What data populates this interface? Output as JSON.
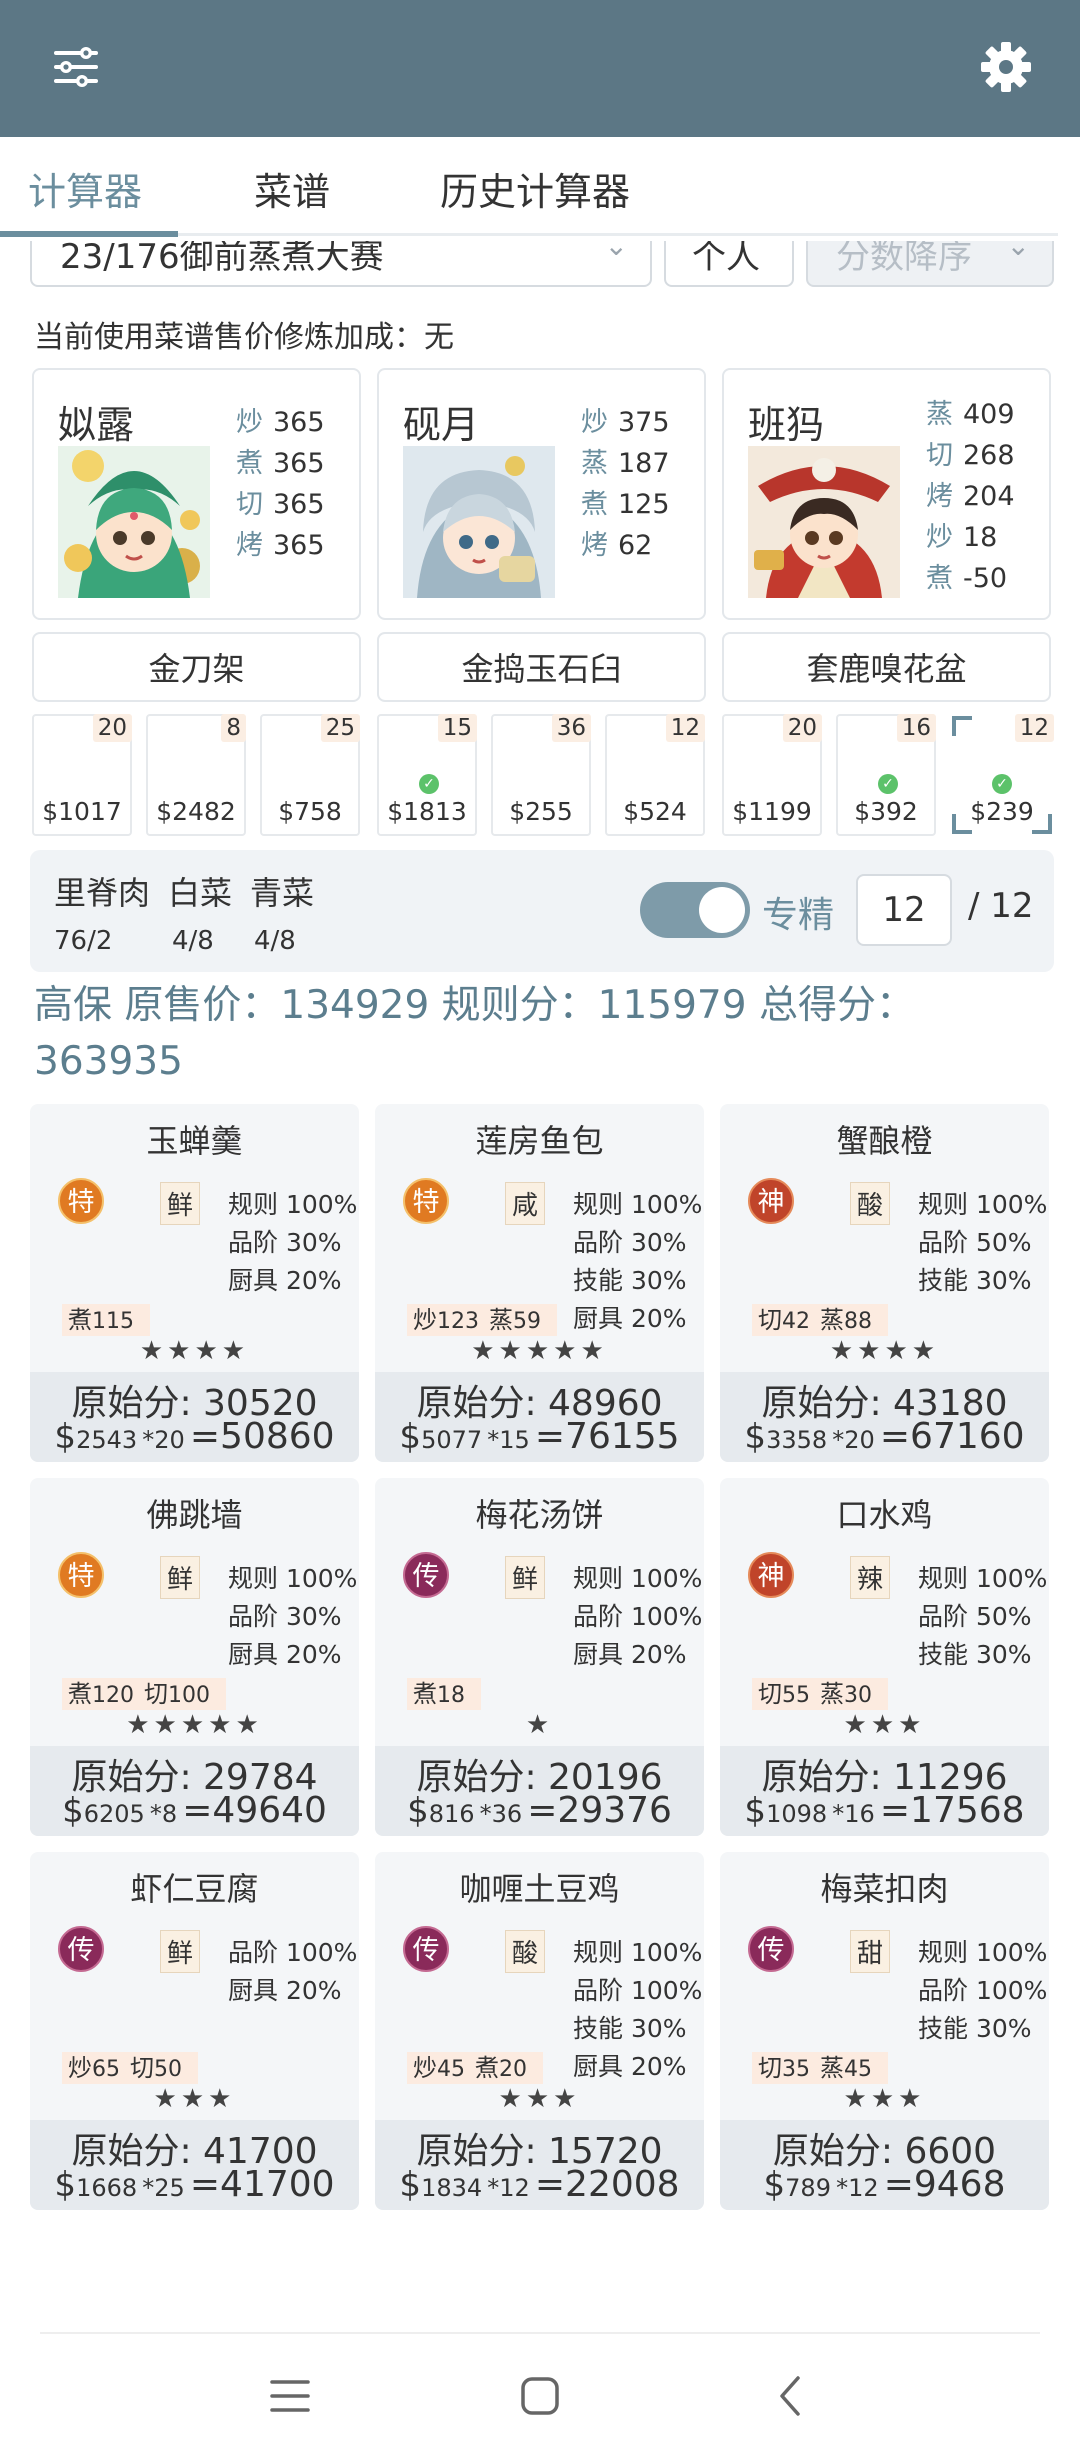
{
  "header": {
    "filter_icon": "sliders-icon",
    "settings_icon": "gear-icon"
  },
  "tabs": [
    {
      "label": "计算器",
      "active": true
    },
    {
      "label": "菜谱",
      "active": false
    },
    {
      "label": "历史计算器",
      "active": false
    }
  ],
  "filters": {
    "contest": "23/176御前蒸煮大赛",
    "mode": "个人",
    "sort": "分数降序"
  },
  "bonus_text": "当前使用菜谱售价修炼加成：无",
  "chefs": [
    {
      "name": "姒露",
      "skills": [
        {
          "k": "炒",
          "v": "365"
        },
        {
          "k": "煮",
          "v": "365"
        },
        {
          "k": "切",
          "v": "365"
        },
        {
          "k": "烤",
          "v": "365"
        }
      ]
    },
    {
      "name": "砚月",
      "skills": [
        {
          "k": "炒",
          "v": "375"
        },
        {
          "k": "蒸",
          "v": "187"
        },
        {
          "k": "煮",
          "v": "125"
        },
        {
          "k": "烤",
          "v": "62"
        }
      ]
    },
    {
      "name": "班犸",
      "skills": [
        {
          "k": "蒸",
          "v": "409"
        },
        {
          "k": "切",
          "v": "268"
        },
        {
          "k": "烤",
          "v": "204"
        },
        {
          "k": "炒",
          "v": "18"
        },
        {
          "k": "煮",
          "v": "-50"
        }
      ]
    }
  ],
  "equipment": [
    "金刀架",
    "金捣玉石臼",
    "套鹿嗅花盆"
  ],
  "slots": [
    {
      "qty": "20",
      "price": "$1017"
    },
    {
      "qty": "8",
      "price": "$2482"
    },
    {
      "qty": "25",
      "price": "$758"
    },
    {
      "qty": "15",
      "price": "$1813"
    },
    {
      "qty": "36",
      "price": "$255"
    },
    {
      "qty": "12",
      "price": "$524"
    },
    {
      "qty": "20",
      "price": "$1199"
    },
    {
      "qty": "16",
      "price": "$392"
    },
    {
      "qty": "12",
      "price": "$239"
    }
  ],
  "materials": [
    {
      "name": "里脊肉",
      "value": "76/2"
    },
    {
      "name": "白菜",
      "value": "4/8"
    },
    {
      "name": "青菜",
      "value": "4/8"
    }
  ],
  "specialize": {
    "label": "专精",
    "on": true,
    "level": "12",
    "total": "/ 12"
  },
  "summary": "高保 原售价：134929 规则分：115979 总得分：363935",
  "recipes": [
    {
      "name": "玉蝉羹",
      "rank": "特",
      "taste": "鲜",
      "rules": [
        "规则 100%",
        "品阶 30%",
        "厨具 20%"
      ],
      "needs": [
        {
          "k": "煮",
          "v": "115"
        }
      ],
      "stars": "★★★★",
      "orig": "原始分: 30520",
      "price": "2543",
      "mult": "*20",
      "total": "=50860"
    },
    {
      "name": "莲房鱼包",
      "rank": "特",
      "taste": "咸",
      "rules": [
        "规则 100%",
        "品阶 30%",
        "技能 30%",
        "厨具 20%"
      ],
      "needs": [
        {
          "k": "炒",
          "v": "123"
        },
        {
          "k": "蒸",
          "v": "59"
        }
      ],
      "stars": "★★★★★",
      "orig": "原始分: 48960",
      "price": "5077",
      "mult": "*15",
      "total": "=76155"
    },
    {
      "name": "蟹酿橙",
      "rank": "神",
      "taste": "酸",
      "rules": [
        "规则 100%",
        "品阶 50%",
        "技能 30%"
      ],
      "needs": [
        {
          "k": "切",
          "v": "42"
        },
        {
          "k": "蒸",
          "v": "88"
        }
      ],
      "stars": "★★★★",
      "orig": "原始分: 43180",
      "price": "3358",
      "mult": "*20",
      "total": "=67160"
    },
    {
      "name": "佛跳墙",
      "rank": "特",
      "taste": "鲜",
      "rules": [
        "规则 100%",
        "品阶 30%",
        "厨具 20%"
      ],
      "needs": [
        {
          "k": "煮",
          "v": "120"
        },
        {
          "k": "切",
          "v": "100"
        }
      ],
      "stars": "★★★★★",
      "orig": "原始分: 29784",
      "price": "6205",
      "mult": "*8",
      "total": "=49640"
    },
    {
      "name": "梅花汤饼",
      "rank": "传",
      "taste": "鲜",
      "rules": [
        "规则 100%",
        "品阶 100%",
        "厨具 20%"
      ],
      "needs": [
        {
          "k": "煮",
          "v": "18"
        }
      ],
      "stars": "★",
      "orig": "原始分: 20196",
      "price": "816",
      "mult": "*36",
      "total": "=29376"
    },
    {
      "name": "口水鸡",
      "rank": "神",
      "taste": "辣",
      "rules": [
        "规则 100%",
        "品阶 50%",
        "技能 30%"
      ],
      "needs": [
        {
          "k": "切",
          "v": "55"
        },
        {
          "k": "蒸",
          "v": "30"
        }
      ],
      "stars": "★★★",
      "orig": "原始分: 11296",
      "price": "1098",
      "mult": "*16",
      "total": "=17568"
    },
    {
      "name": "虾仁豆腐",
      "rank": "传",
      "taste": "鲜",
      "rules": [
        "品阶 100%",
        "厨具 20%"
      ],
      "needs": [
        {
          "k": "炒",
          "v": "65"
        },
        {
          "k": "切",
          "v": "50"
        }
      ],
      "stars": "★★★",
      "orig": "原始分: 41700",
      "price": "1668",
      "mult": "*25",
      "total": "=41700"
    },
    {
      "name": "咖喱土豆鸡",
      "rank": "传",
      "taste": "酸",
      "rules": [
        "规则 100%",
        "品阶 100%",
        "技能 30%",
        "厨具 20%"
      ],
      "needs": [
        {
          "k": "炒",
          "v": "45"
        },
        {
          "k": "煮",
          "v": "20"
        }
      ],
      "stars": "★★★",
      "orig": "原始分: 15720",
      "price": "1834",
      "mult": "*12",
      "total": "=22008"
    },
    {
      "name": "梅菜扣肉",
      "rank": "传",
      "taste": "甜",
      "rules": [
        "规则 100%",
        "品阶 100%",
        "技能 30%"
      ],
      "needs": [
        {
          "k": "切",
          "v": "35"
        },
        {
          "k": "蒸",
          "v": "45"
        }
      ],
      "stars": "★★★",
      "orig": "原始分: 6600",
      "price": "789",
      "mult": "*12",
      "total": "=9468"
    }
  ],
  "navbar": {
    "menu_icon": "menu-icon",
    "home_icon": "home-icon",
    "back_icon": "back-icon"
  }
}
